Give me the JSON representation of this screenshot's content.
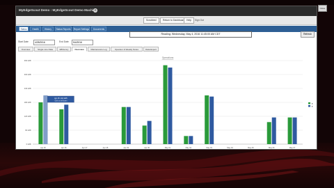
{
  "window": {
    "title": "MyEdgeScout Demo : MyEdgeScout Demo Machine"
  },
  "toolbar": {
    "btn_a": "Scrubbed",
    "btn_b": "Return to Dashboard",
    "btn_c": "Help",
    "btn_d": "Sign Out",
    "corner": "Close"
  },
  "nav_tabs": [
    "Status",
    "Health",
    "History",
    "Status Reports",
    "Report Settings",
    "Documents"
  ],
  "status_banner": "Reading: Wednesday, May 4, 2016 11:45:00 AM CDT",
  "refresh_label": "Refresh",
  "dates": {
    "start_label": "Start Date",
    "start_value": "4/25/2016",
    "end_label": "End Date",
    "end_value": "5/4/2016"
  },
  "sub_tabs": [
    "Overview",
    "Single Line Data",
    "Efficiency",
    "Overview",
    "Maintenance Log",
    "Operator & Weekly Notes",
    "Data Export"
  ],
  "chart_data": {
    "type": "bar",
    "title": "Operations",
    "categories": [
      "Apr 25",
      "Apr 26",
      "Apr 27",
      "Apr 28",
      "Apr 29",
      "Apr 30",
      "May 01",
      "May 02",
      "May 03",
      "May 04",
      "May 05",
      "May 06",
      "May 07"
    ],
    "y_ticks": [
      "0 kWh",
      "60 kWh",
      "120 kWh",
      "180 kWh",
      "240 kWh",
      "300 kWh",
      "360 kWh"
    ],
    "ylim": [
      0,
      360
    ],
    "series": [
      {
        "name": "■",
        "color": "#2a9a3a",
        "values": [
          180,
          150,
          0,
          0,
          160,
          80,
          340,
          35,
          210,
          0,
          0,
          95,
          115
        ]
      },
      {
        "name": "■",
        "color": "#2f5aa0",
        "values": [
          210,
          170,
          0,
          0,
          160,
          100,
          330,
          35,
          205,
          0,
          0,
          115,
          115
        ]
      }
    ],
    "tooltip": {
      "line1": "Apr 25: 210 kWh",
      "line2": "Click to drill down"
    },
    "grid": true,
    "legend_position": "right"
  }
}
